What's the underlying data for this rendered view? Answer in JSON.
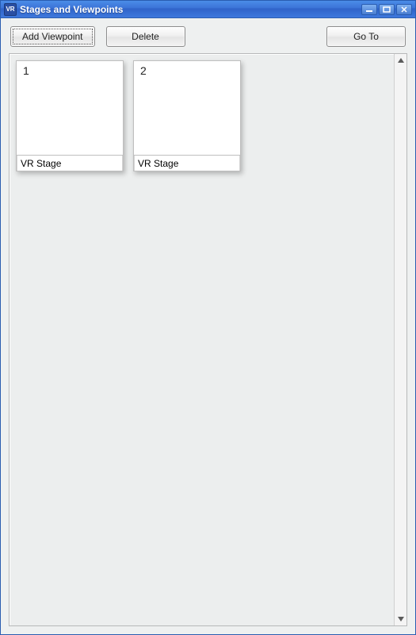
{
  "window": {
    "title": "Stages and Viewpoints",
    "icon_label": "VR"
  },
  "toolbar": {
    "add_label": "Add Viewpoint",
    "delete_label": "Delete",
    "goto_label": "Go To"
  },
  "viewpoints": [
    {
      "index": "1",
      "label": "VR Stage"
    },
    {
      "index": "2",
      "label": "VR Stage"
    }
  ]
}
